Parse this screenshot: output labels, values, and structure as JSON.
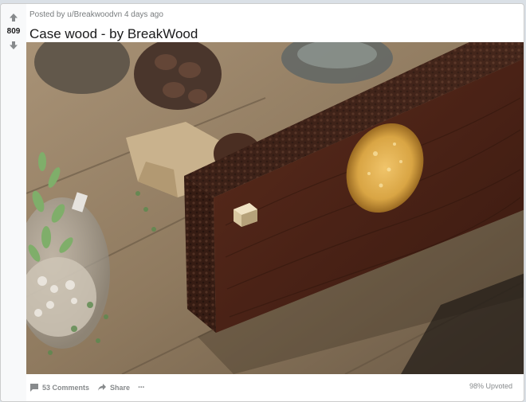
{
  "post": {
    "meta": "Posted by u/Breakwoodvn 4 days ago",
    "title": "Case wood - by BreakWood",
    "score": "809"
  },
  "footer": {
    "comments_label": "53 Comments",
    "share_label": "Share",
    "more_label": "···",
    "upvoted_label": "98% Upvoted"
  },
  "icons": {
    "upvote": "arrow-up-icon",
    "downvote": "arrow-down-icon",
    "comments": "comment-icon",
    "share": "share-icon",
    "more": "ellipsis-icon"
  },
  "colors": {
    "background": "#dae0e6",
    "card": "#ffffff",
    "muted_text": "#878a8c",
    "title_text": "#1a1a1b",
    "wood": "#4a2418",
    "gold_inlay": "#d9a544"
  }
}
